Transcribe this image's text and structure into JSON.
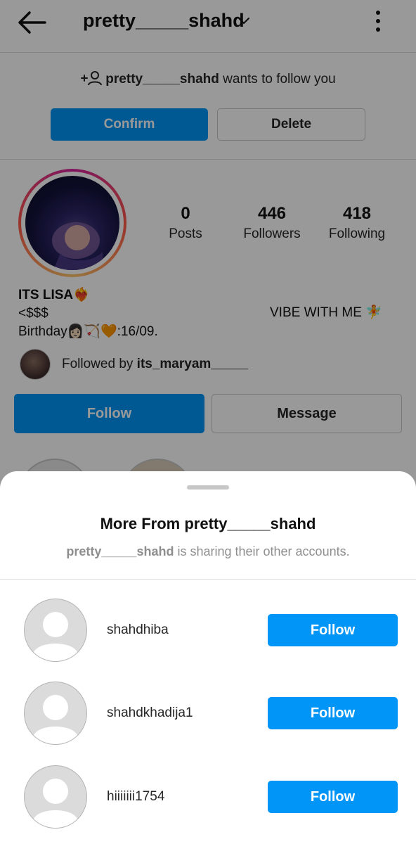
{
  "header": {
    "username": "pretty_____shahd"
  },
  "follow_request": {
    "username": "pretty_____shahd",
    "text": "wants to follow you",
    "confirm_label": "Confirm",
    "delete_label": "Delete"
  },
  "profile": {
    "stats": [
      {
        "number": "0",
        "label": "Posts"
      },
      {
        "number": "446",
        "label": "Followers"
      },
      {
        "number": "418",
        "label": "Following"
      }
    ],
    "bio": {
      "name": "ITS LISA❤️‍🔥",
      "line1": "<$$$",
      "line2": "Birthday👩🏻🏹🧡:16/09.",
      "right_text": "VIBE WITH ME 🧚"
    },
    "followed_by_prefix": "Followed by",
    "followed_by_user": "its_maryam_____",
    "follow_label": "Follow",
    "message_label": "Message"
  },
  "sheet": {
    "title": "More From pretty_____shahd",
    "subtitle_user": "pretty_____shahd",
    "subtitle_text": "is sharing their other accounts.",
    "accounts": [
      {
        "username": "shahdhiba",
        "button": "Follow"
      },
      {
        "username": "shahdkhadija1",
        "button": "Follow"
      },
      {
        "username": "hiiiiiii1754",
        "button": "Follow"
      }
    ]
  },
  "colors": {
    "primary": "#0095f6",
    "divider": "#dbdbdb",
    "muted": "#8e8e8e"
  }
}
